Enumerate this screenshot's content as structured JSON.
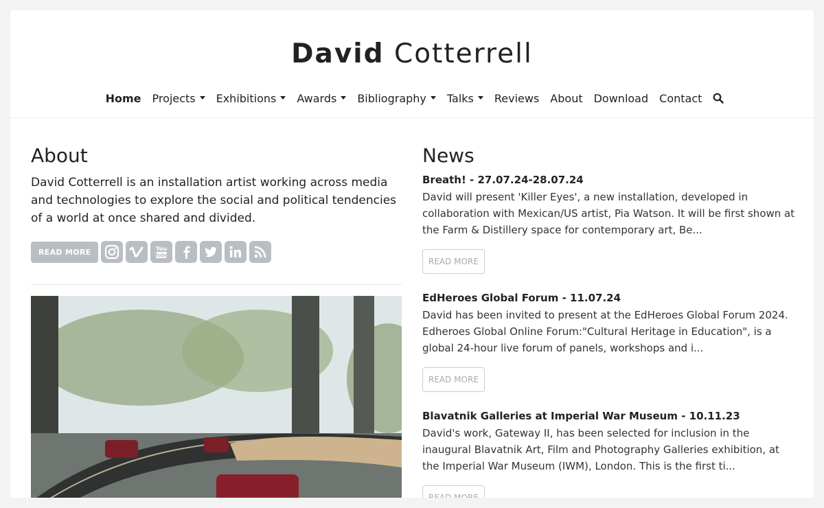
{
  "site": {
    "title_first": "David",
    "title_last": "Cotterrell"
  },
  "nav": {
    "items": [
      {
        "label": "Home",
        "dropdown": false,
        "active": true
      },
      {
        "label": "Projects",
        "dropdown": true
      },
      {
        "label": "Exhibitions",
        "dropdown": true
      },
      {
        "label": "Awards",
        "dropdown": true
      },
      {
        "label": "Bibliography",
        "dropdown": true
      },
      {
        "label": "Talks",
        "dropdown": true
      },
      {
        "label": "Reviews",
        "dropdown": false
      },
      {
        "label": "About",
        "dropdown": false
      },
      {
        "label": "Download",
        "dropdown": false
      },
      {
        "label": "Contact",
        "dropdown": false
      }
    ],
    "search_icon": "search-icon"
  },
  "about": {
    "heading": "About",
    "text": "David Cotterrell is an installation artist working across media and technologies to explore the social and political tendencies of a world at once shared and divided.",
    "read_more": "READ MORE",
    "social_icons": [
      "instagram-icon",
      "vimeo-icon",
      "youtube-icon",
      "facebook-icon",
      "twitter-icon",
      "linkedin-icon",
      "rss-icon"
    ]
  },
  "news": {
    "heading": "News",
    "items": [
      {
        "title": "Breath! - 27.07.24-28.07.24",
        "text": "David will present 'Killer Eyes', a new installation, developed in collaboration with Mexican/US artist, Pia Watson. It will be first shown at the Farm & Distillery space for contemporary art, Be...",
        "button": "READ MORE"
      },
      {
        "title": "EdHeroes Global Forum - 11.07.24",
        "text": "David has been invited to present at the EdHeroes Global Forum 2024. Edheroes Global Online Forum:\"Cultural Heritage in Education\", is a global 24-hour live forum of panels, workshops and i...",
        "button": "READ MORE"
      },
      {
        "title": "Blavatnik Galleries at Imperial War Museum - 10.11.23",
        "text": "David's work, Gateway II, has been selected for inclusion in the inaugural Blavatnik Art, Film and Photography Galleries exhibition, at the Imperial War Museum (IWM), London. This is the first ti...",
        "button": "READ MORE"
      }
    ]
  },
  "colors": {
    "social_grey": "#b9bec3",
    "text": "#222222"
  }
}
